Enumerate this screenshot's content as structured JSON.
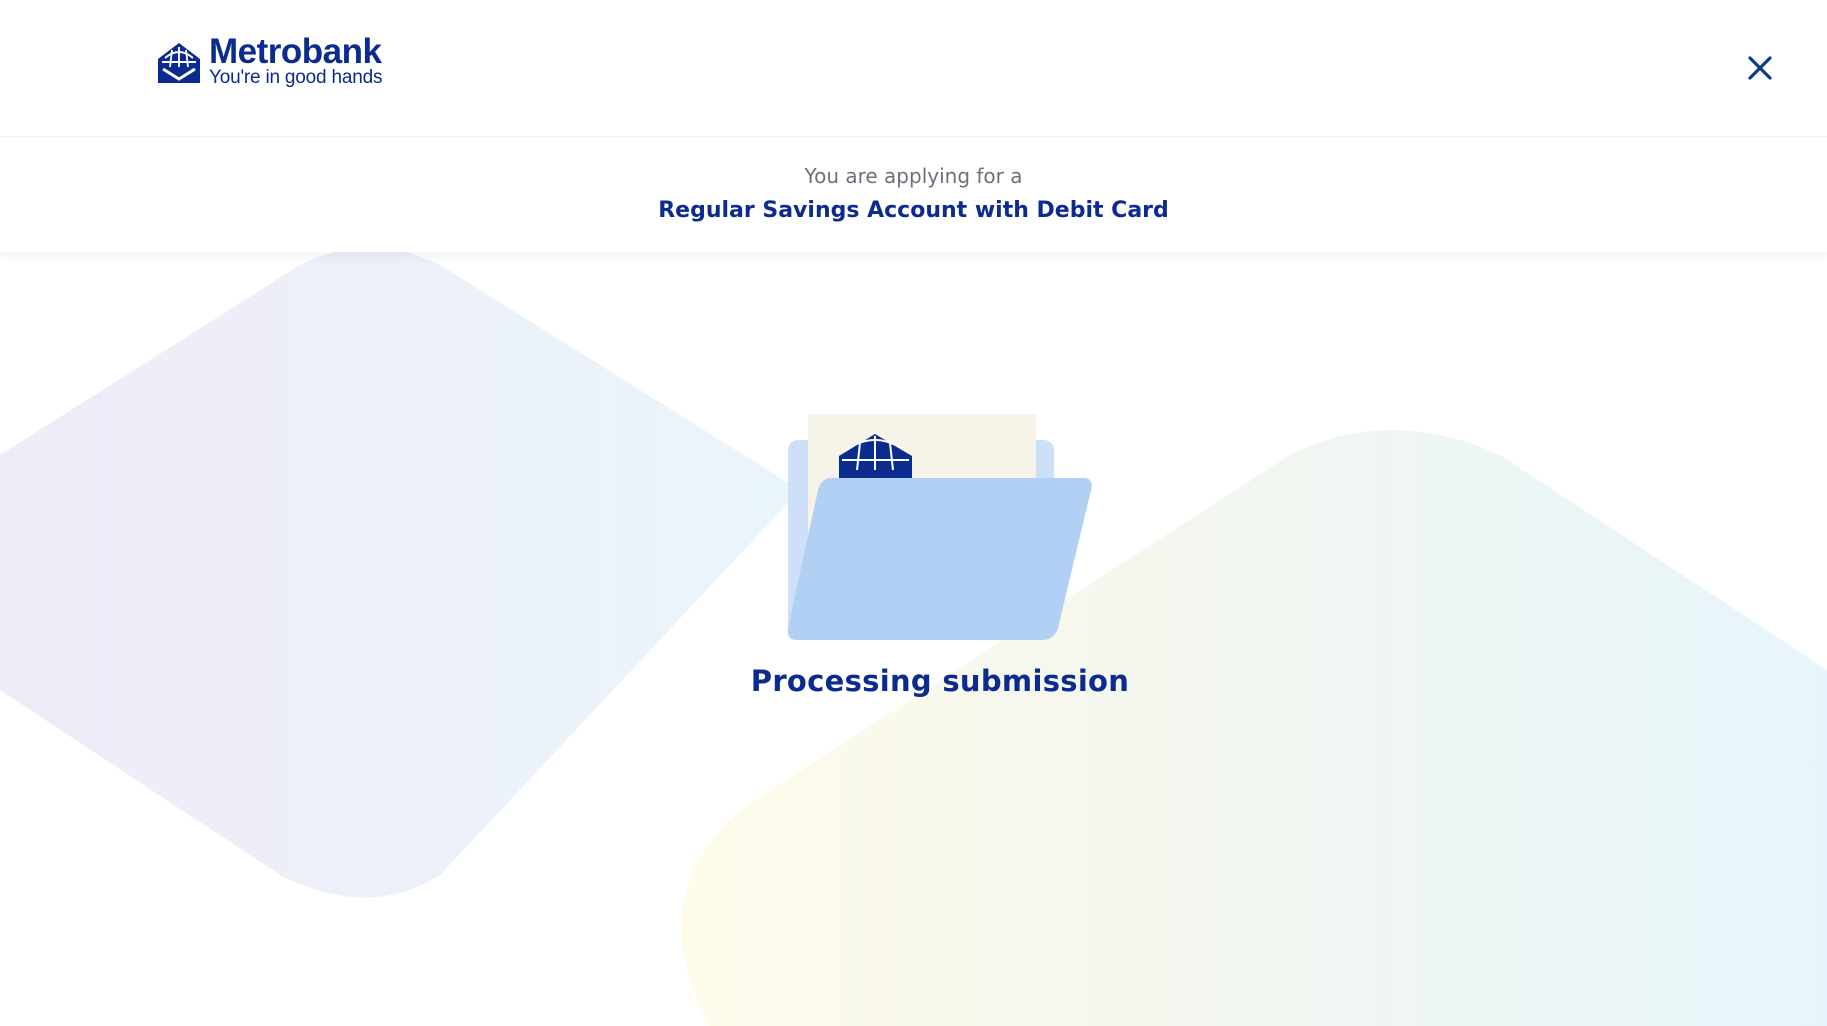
{
  "header": {
    "brand_name": "Metrobank",
    "brand_tagline": "You're in good hands",
    "logo_icon": "metrobank-logo-icon",
    "close_icon": "close-icon"
  },
  "application": {
    "intro_text": "You are applying for a",
    "product_name": "Regular Savings Account with Debit Card"
  },
  "status": {
    "illustration_icon": "folder-icon",
    "message": "Processing submission"
  },
  "colors": {
    "brand_navy": "#0b2b8f",
    "folder_blue": "#b1d0f3",
    "muted_text": "#6b717c"
  }
}
